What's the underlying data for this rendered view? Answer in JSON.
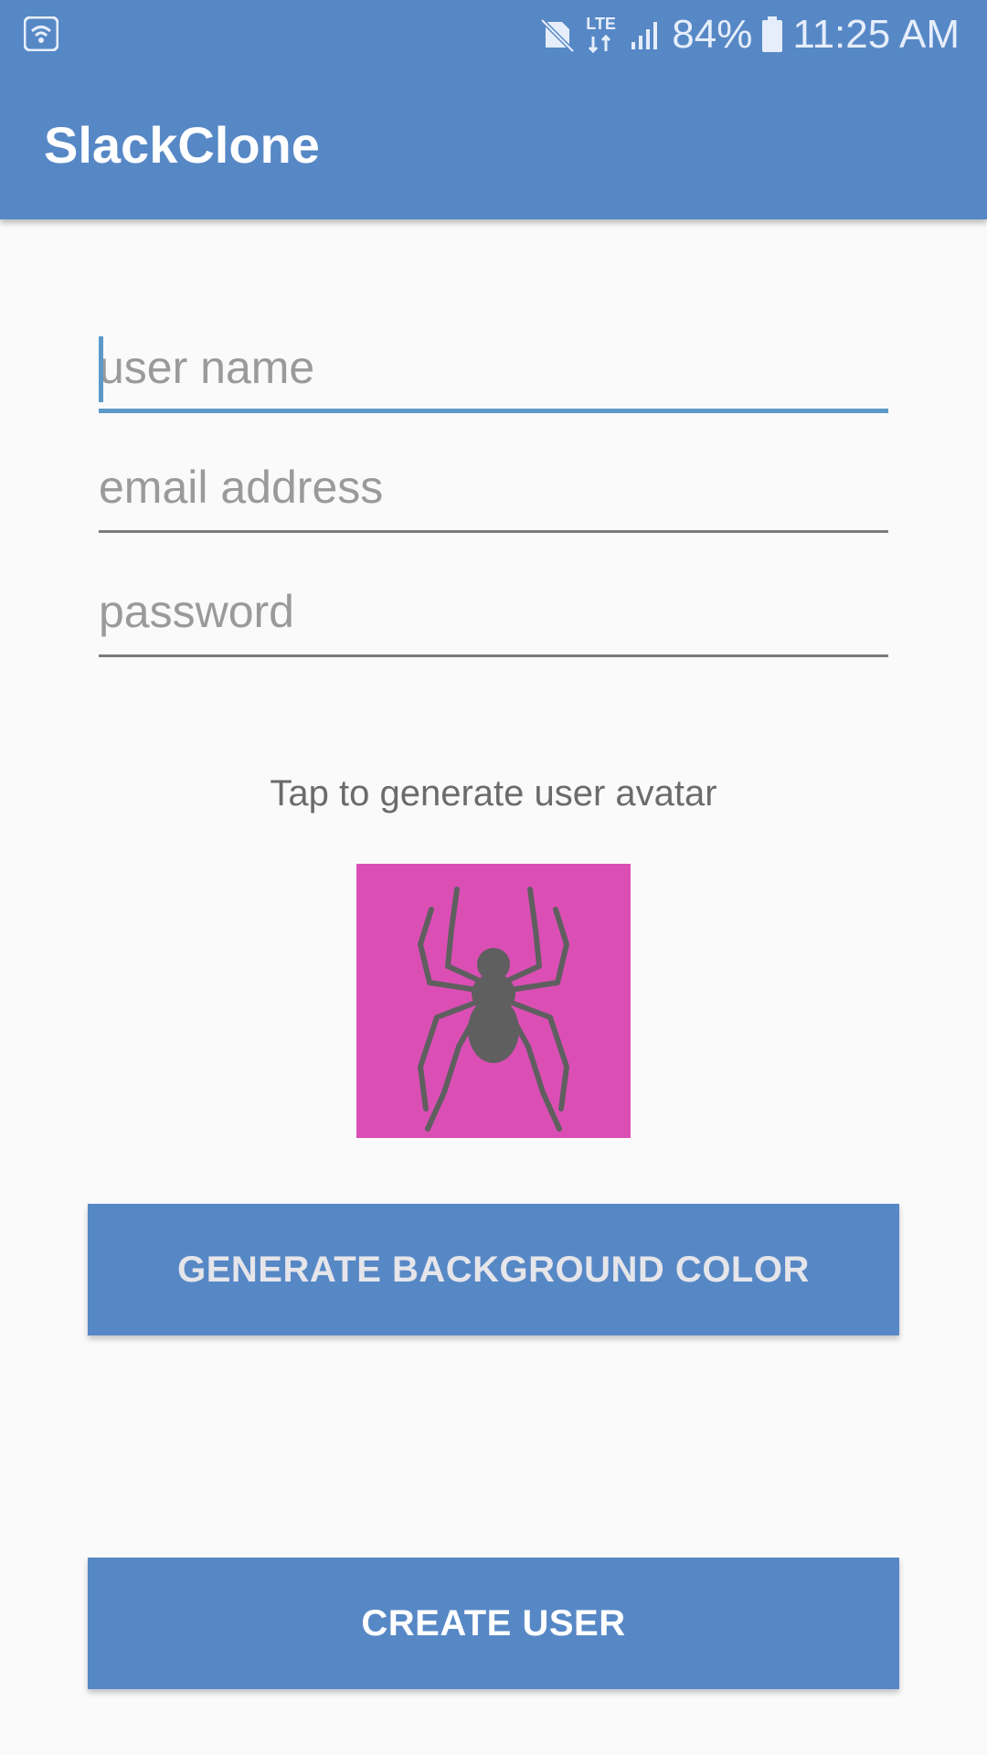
{
  "status_bar": {
    "battery": "84%",
    "time": "11:25 AM",
    "network": "LTE",
    "icons": [
      "wifi-icon",
      "no-sim-icon",
      "lte-icon",
      "signal-icon",
      "battery-icon"
    ]
  },
  "app_bar": {
    "title": "SlackClone"
  },
  "form": {
    "username_placeholder": "user name",
    "email_placeholder": "email address",
    "password_placeholder": "password"
  },
  "avatar": {
    "prompt": "Tap to generate user avatar",
    "background_color": "#db4fb5",
    "icon": "spider-icon"
  },
  "buttons": {
    "generate_bg": "GENERATE BACKGROUND COLOR",
    "create_user": "CREATE USER"
  },
  "colors": {
    "primary": "#5788c6",
    "focus_accent": "#5b9ac8"
  }
}
